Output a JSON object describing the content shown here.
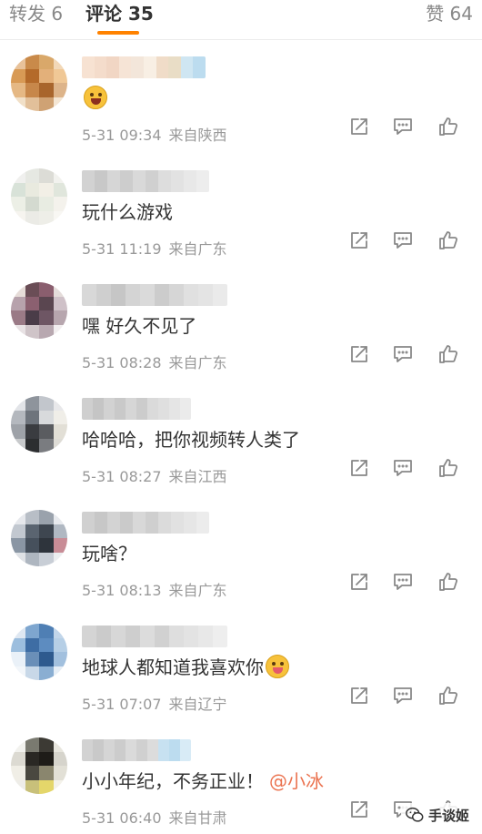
{
  "tabs": [
    {
      "label": "转发 6",
      "active": false
    },
    {
      "label": "评论 35",
      "active": true
    },
    {
      "label": "赞 64",
      "active": false
    }
  ],
  "accent_color": "#ff8200",
  "comments": [
    {
      "content": "",
      "emoji": "laughing-emoji",
      "time": "5-31 09:34",
      "location": "来自陕西",
      "avatar_colors": [
        "#e8c29a",
        "#c98a4a",
        "#d9a86a",
        "#f2d8b8",
        "#d89a55",
        "#b46a2a",
        "#e3b07a",
        "#f0c896",
        "#e5b884",
        "#c7874a",
        "#a8652c",
        "#ddb48a",
        "#f1e0c8",
        "#e2c09a",
        "#cfa274",
        "#f4e6d4"
      ],
      "name_colors": [
        "#f7e2d2",
        "#f4dccb",
        "#f1d6c4",
        "#f6e4d6",
        "#f3e6da",
        "#f8efe4",
        "#f0dcc8",
        "#e9ddc6",
        "#cfe6f2",
        "#bcdcef"
      ]
    },
    {
      "content": "玩什么游戏",
      "emoji": "",
      "time": "5-31 11:19",
      "location": "来自广东",
      "avatar_colors": [
        "#f0f0ee",
        "#e6e8e2",
        "#dcdcd6",
        "#f2f2ee",
        "#d8e2d8",
        "#e9eadf",
        "#f2efe6",
        "#e0e6dc",
        "#ecefe6",
        "#d4dad0",
        "#e8ece2",
        "#f4f2ec",
        "#f6f4ef",
        "#ebebe6",
        "#eeeee8",
        "#f8f7f3"
      ],
      "name_colors": [
        "#d2d2d2",
        "#c8c8c8",
        "#d6d6d6",
        "#cdcdcd",
        "#d9d9d9",
        "#d0d0d0",
        "#dddddd",
        "#e2e2e2",
        "#e8e8e8",
        "#ededed"
      ]
    },
    {
      "content": "嘿 好久不见了",
      "emoji": "",
      "time": "5-31 08:28",
      "location": "来自广东",
      "avatar_colors": [
        "#e6dcd8",
        "#6a4d56",
        "#8a5e6e",
        "#e4dcda",
        "#b7a2ac",
        "#8b6070",
        "#5a4650",
        "#cfc1c8",
        "#9a7a86",
        "#4a3c48",
        "#6e5664",
        "#b7a6ae",
        "#e8e2e4",
        "#cfc4c8",
        "#b8a8b0",
        "#f2eeef"
      ],
      "name_colors": [
        "#d8d8d8",
        "#cfcfcf",
        "#c6c6c6",
        "#d4d4d4",
        "#dadada",
        "#cccccc",
        "#d6d6d6",
        "#e0e0e0",
        "#e4e4e4",
        "#eaeaea"
      ]
    },
    {
      "content": "哈哈哈，把你视频转人类了",
      "emoji": "",
      "time": "5-31 08:27",
      "location": "来自江西",
      "avatar_colors": [
        "#e2e4e8",
        "#8e949c",
        "#c2c6cc",
        "#e8e8ea",
        "#b4b8be",
        "#6e747c",
        "#d8dadc",
        "#f0eee8",
        "#9ea2a8",
        "#3a3c40",
        "#5a5c60",
        "#e2dfd6",
        "#c8cacc",
        "#2c2e30",
        "#7a7c80",
        "#dedcd6"
      ],
      "name_colors": [
        "#cfcfcf",
        "#c5c5c5",
        "#d2d2d2",
        "#c9c9c9",
        "#d6d6d6",
        "#cccccc",
        "#dadada",
        "#dfdfdf",
        "#e5e5e5",
        "#ebebeb"
      ]
    },
    {
      "content": "玩啥？",
      "emoji": "",
      "time": "5-31 08:13",
      "location": "来自广东",
      "avatar_colors": [
        "#e6e8ec",
        "#b8bec6",
        "#9aa2ac",
        "#e8eaee",
        "#c2c8d0",
        "#5a6470",
        "#3e4650",
        "#b0b8c2",
        "#8a96a4",
        "#46505c",
        "#2e343c",
        "#c88c96",
        "#dfe2e6",
        "#aeb6c0",
        "#c8ced6",
        "#eceef0"
      ],
      "name_colors": [
        "#d0d0d0",
        "#c7c7c7",
        "#d3d3d3",
        "#cacaca",
        "#d8d8d8",
        "#cfcfcf",
        "#dbdbdb",
        "#e1e1e1",
        "#e6e6e6",
        "#ececec"
      ]
    },
    {
      "content": "地球人都知道我喜欢你",
      "emoji": "tongue-emoji",
      "time": "5-31 07:07",
      "location": "来自辽宁",
      "avatar_colors": [
        "#dfe8f2",
        "#7ea6cf",
        "#4f7fb4",
        "#c2d6ea",
        "#9cbede",
        "#3e6da4",
        "#5d8cc0",
        "#b6cfe6",
        "#eaf1f8",
        "#6a8fb8",
        "#2e5a8e",
        "#a2c0de",
        "#f2f6fa",
        "#c8d8e8",
        "#8aaed2",
        "#e6eef6"
      ],
      "name_colors": [
        "#d4d4d4",
        "#cbcbcb",
        "#d7d7d7",
        "#cecece",
        "#dcdcdc",
        "#d1d1d1",
        "#dedede",
        "#e3e3e3",
        "#e8e8e8",
        "#eeeeee"
      ]
    },
    {
      "content": "小小年纪，不务正业！",
      "mention": "@小冰",
      "emoji": "",
      "time": "5-31 06:40",
      "location": "来自甘肃",
      "avatar_colors": [
        "#f2f2ee",
        "#7a7a70",
        "#3c3a34",
        "#e8e6de",
        "#dcdad2",
        "#2a2824",
        "#1e1c18",
        "#d6d4cc",
        "#f0eee6",
        "#4a4840",
        "#8a866e",
        "#e2e0d6",
        "#eeede8",
        "#c8c07a",
        "#e4d66a",
        "#f4f2ea"
      ],
      "name_colors": [
        "#d2d2d2",
        "#c9c9c9",
        "#d5d5d5",
        "#cccccc",
        "#dadada",
        "#d0d0d0",
        "#dcdcdc",
        "#c7e1f1",
        "#bcdcef",
        "#d8ebf6"
      ]
    }
  ],
  "watermark": {
    "label": "手谈姬"
  },
  "icons": {
    "share": "share-icon",
    "reply": "comment-icon",
    "like": "thumb-up-icon"
  }
}
